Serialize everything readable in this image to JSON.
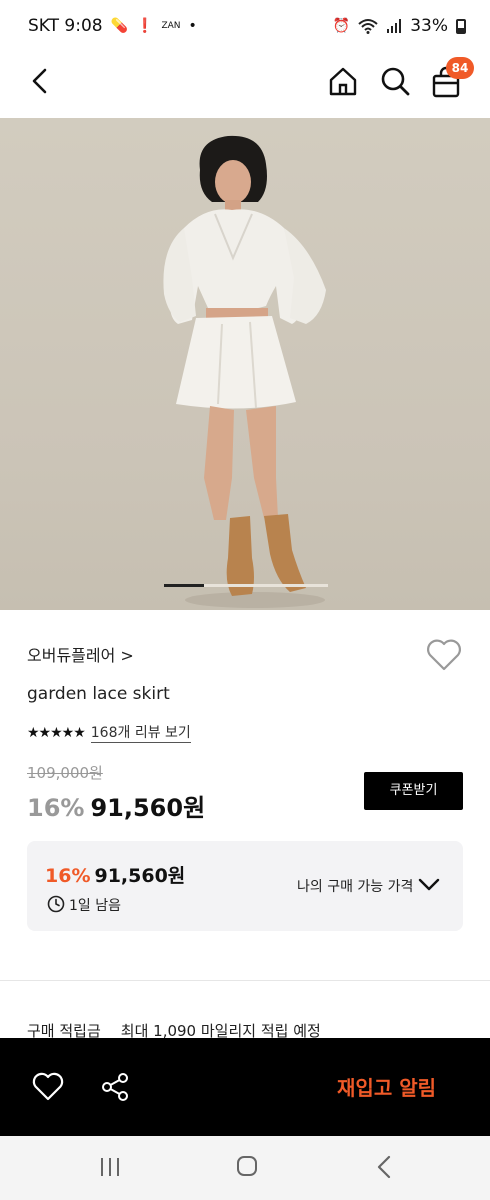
{
  "status_bar": {
    "carrier_time": "SKT 9:08",
    "battery": "33%",
    "left_icons": [
      "pill-icon",
      "paw-icon",
      "small-logo-icon",
      "dot-icon"
    ],
    "right_icons": [
      "alarm-icon",
      "wifi-icon",
      "signal-icon",
      "battery-icon"
    ]
  },
  "header": {
    "cart_count": "84",
    "icons": [
      "back-icon",
      "home-icon",
      "search-icon",
      "shopping-bag-icon"
    ]
  },
  "gallery": {
    "indicator_position": "1"
  },
  "product": {
    "brand": "오버듀플레어 >",
    "name": "garden lace skirt",
    "stars": "★★★★★",
    "review_link": "168개 리뷰 보기",
    "original_price": "109,000원",
    "discount": "16%",
    "price": "91,560원",
    "coupon_button": "쿠폰받기"
  },
  "my_price_box": {
    "discount": "16%",
    "price": "91,560원",
    "remaining": "1일 남음",
    "my_price_label": "나의 구매 가능 가격"
  },
  "points": {
    "label": "구매 적립금",
    "value": "최대 1,090 마일리지 적립 예정"
  },
  "bottom_bar": {
    "restock_button": "재입고 알림",
    "accent": "#f05a28"
  }
}
